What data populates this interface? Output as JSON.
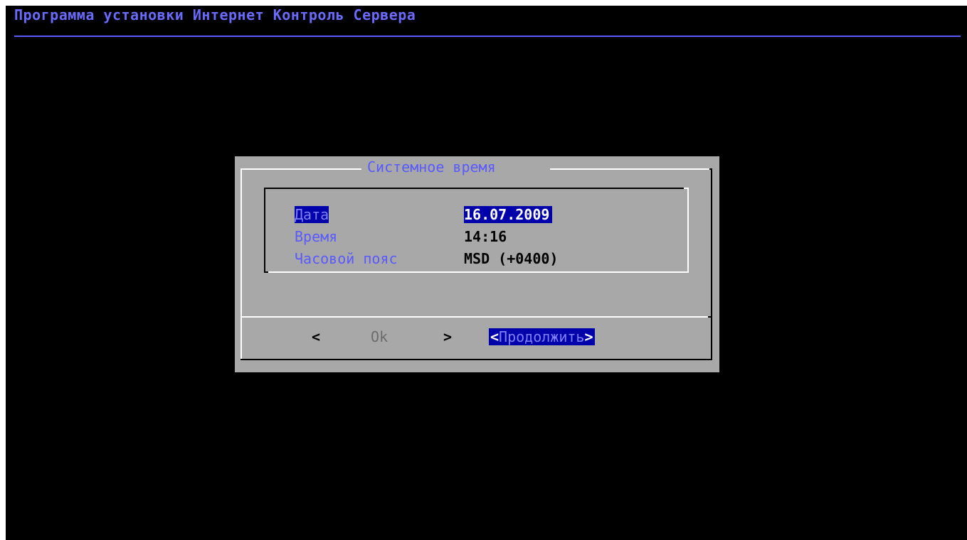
{
  "header": {
    "title": "Программа установки Интернет Контроль Сервера"
  },
  "dialog": {
    "title": "Системное время",
    "fields": [
      {
        "label": "Дата",
        "value": "16.07.2009"
      },
      {
        "label": "Время",
        "value": "14:16"
      },
      {
        "label": "Часовой пояс",
        "value": "MSD (+0400)"
      }
    ],
    "buttons": {
      "prev": "<",
      "ok": "Ok",
      "next": ">",
      "continue_open": "<",
      "continue_label": "Продолжить",
      "continue_close": ">"
    }
  },
  "colors": {
    "background": "#000000",
    "dialog_bg": "#a8a8a8",
    "accent": "#5a5aff",
    "selection": "#0000aa"
  }
}
